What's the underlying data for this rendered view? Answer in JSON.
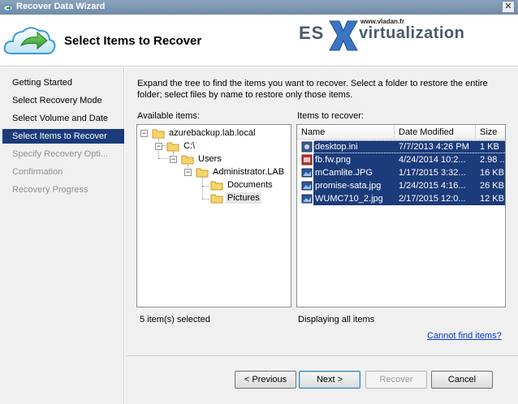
{
  "window": {
    "title": "Recover Data Wizard",
    "close_glyph": "✕"
  },
  "header": {
    "page_title": "Select Items to Recover",
    "brand": {
      "url": "www.vladan.fr",
      "es": "ES",
      "virt": "virtualization"
    }
  },
  "nav": {
    "items": [
      {
        "label": "Getting Started",
        "state": "normal"
      },
      {
        "label": "Select Recovery Mode",
        "state": "normal"
      },
      {
        "label": "Select Volume and Date",
        "state": "normal"
      },
      {
        "label": "Select Items to Recover",
        "state": "selected"
      },
      {
        "label": "Specify Recovery Opti...",
        "state": "disabled"
      },
      {
        "label": "Confirmation",
        "state": "disabled"
      },
      {
        "label": "Recovery Progress",
        "state": "disabled"
      }
    ]
  },
  "main": {
    "instructions": "Expand the tree to find the items you want to recover. Select a folder to restore the entire folder; select files by name to restore only those items.",
    "available_label": "Available items:",
    "recover_label": "Items to recover:",
    "tree": [
      {
        "label": "azurebackup.lab.local",
        "expander": "−"
      },
      {
        "label": "C:\\",
        "expander": "−"
      },
      {
        "label": "Users",
        "expander": "−"
      },
      {
        "label": "Administrator.LAB",
        "expander": "−"
      },
      {
        "label": "Documents",
        "expander": ""
      },
      {
        "label": "Pictures",
        "expander": ""
      }
    ],
    "columns": {
      "name": "Name",
      "modified": "Date Modified",
      "size": "Size"
    },
    "files": [
      {
        "name": "desktop.ini",
        "modified": "7/7/2013 4:26 PM",
        "size": "1 KB",
        "icon": "ini-file-icon"
      },
      {
        "name": "fb.fw.png",
        "modified": "4/24/2014 10:2...",
        "size": "2.98 ...",
        "icon": "png-file-icon"
      },
      {
        "name": "mCamlite.JPG",
        "modified": "1/17/2015 3:32...",
        "size": "16 KB",
        "icon": "jpg-file-icon"
      },
      {
        "name": "promise-sata.jpg",
        "modified": "1/24/2015 4:16...",
        "size": "26 KB",
        "icon": "jpg-file-icon"
      },
      {
        "name": "WUMC710_2.jpg",
        "modified": "2/17/2015 12:0...",
        "size": "12 KB",
        "icon": "jpg-file-icon"
      }
    ],
    "selected_count": "5 item(s) selected",
    "display_status": "Displaying all items",
    "cannot_find_link": "Cannot find items?"
  },
  "footer": {
    "previous": "< Previous",
    "next": "Next >",
    "recover": "Recover",
    "cancel": "Cancel"
  },
  "colors": {
    "selection": "#1b3b7a",
    "link": "#0033cc",
    "panel": "#f0f0f0"
  }
}
